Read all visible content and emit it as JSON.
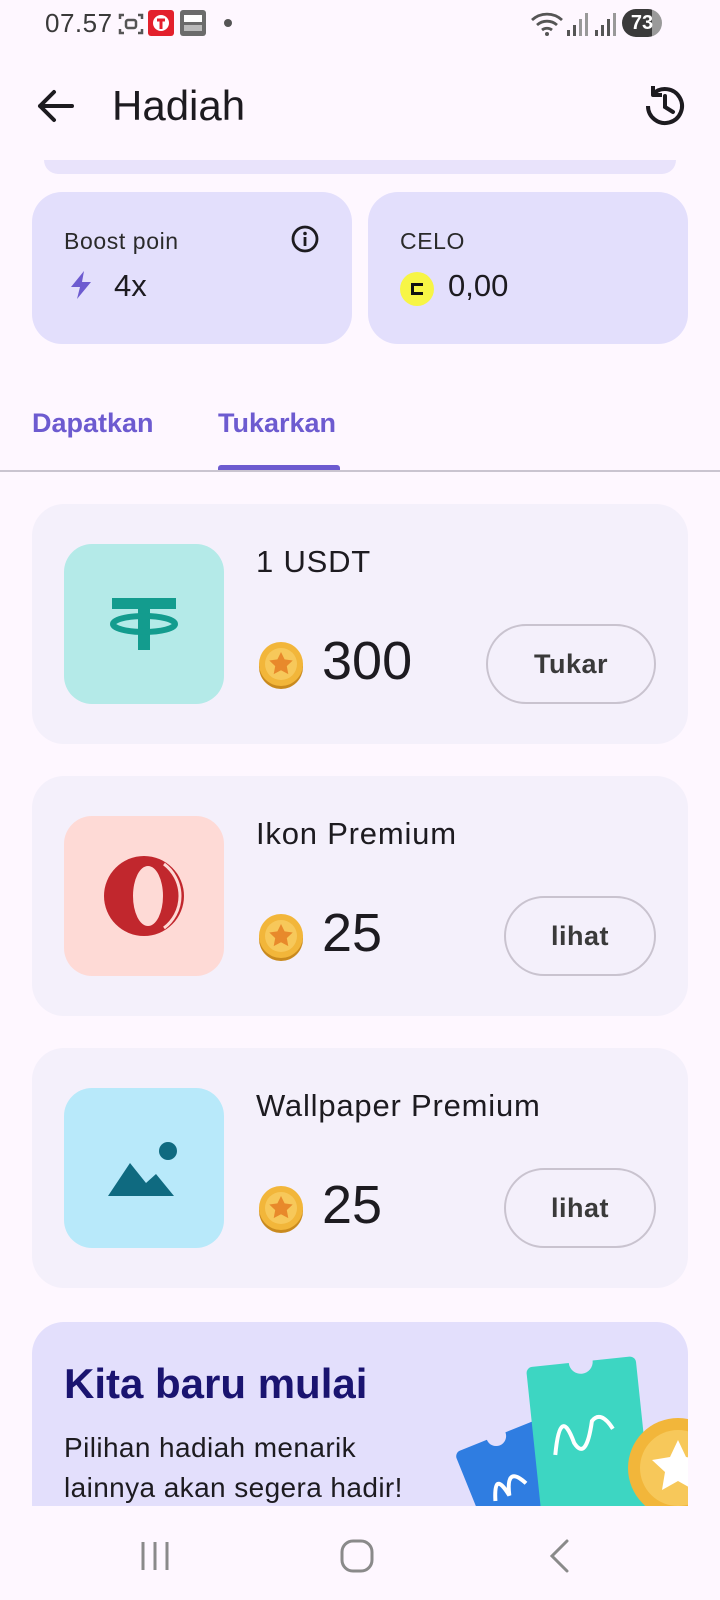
{
  "status_bar": {
    "time": "07.57",
    "battery": "73",
    "icons": [
      "screenshot-icon",
      "telkomsel-icon",
      "brimo-icon",
      "notification-dot",
      "wifi-icon",
      "signal-icon",
      "signal-icon",
      "battery-icon"
    ]
  },
  "app_bar": {
    "title": "Hadiah",
    "back_icon": "arrow-back-icon",
    "history_icon": "history-icon"
  },
  "boost": {
    "label": "Boost poin",
    "value": "4x",
    "icon": "bolt-icon",
    "info_icon": "info-icon"
  },
  "celo": {
    "label": "CELO",
    "value": "0,00",
    "icon": "celo-icon"
  },
  "tabs": [
    {
      "label": "Dapatkan",
      "selected": false
    },
    {
      "label": "Tukarkan",
      "selected": true
    }
  ],
  "rewards": [
    {
      "name": "1 USDT",
      "price": "300",
      "button": "Tukar",
      "icon": "tether-icon",
      "thumb_color": "#B4EAE8"
    },
    {
      "name": "Ikon Premium",
      "price": "25",
      "button": "lihat",
      "icon": "opera-icon",
      "thumb_color": "#FEDAD6"
    },
    {
      "name": "Wallpaper Premium",
      "price": "25",
      "button": "lihat",
      "icon": "landscape-icon",
      "thumb_color": "#B8E9FA"
    }
  ],
  "promo": {
    "title": "Kita baru mulai",
    "text": "Pilihan hadiah menarik lainnya akan segera hadir!"
  },
  "nav_bar": {
    "icons": [
      "recent-apps-icon",
      "home-icon",
      "back-icon"
    ]
  },
  "colors": {
    "accent": "#6D5BD0",
    "card_bg": "#E3DFFC",
    "reward_bg": "#F4F0FB",
    "page_bg": "#FEF7FF",
    "coin": "#F2B63A"
  }
}
